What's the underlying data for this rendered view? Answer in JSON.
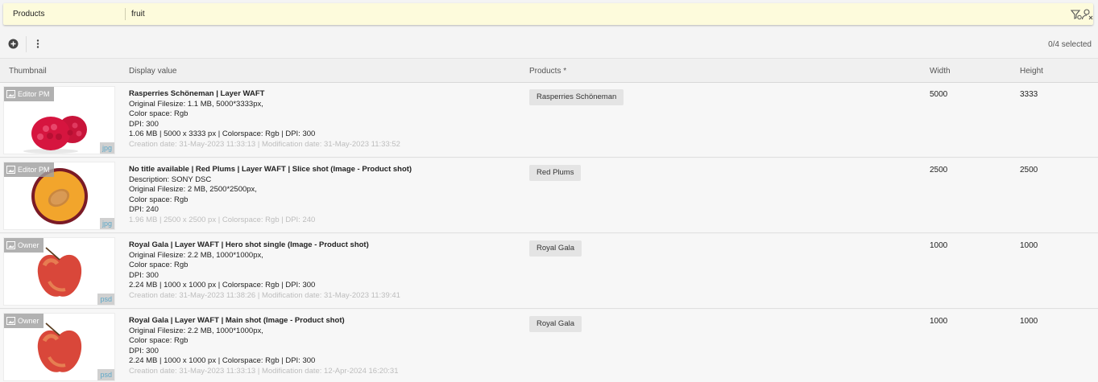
{
  "search": {
    "scope": "Products",
    "query": "fruit"
  },
  "toolbar": {
    "selection": "0/4 selected"
  },
  "columns": {
    "thumbnail": "Thumbnail",
    "display_value": "Display value",
    "products": "Products *",
    "width": "Width",
    "height": "Height"
  },
  "rows": [
    {
      "badge": "Editor PM",
      "ext": "jpg",
      "title": "Rasperries Schöneman | Layer WAFT",
      "lines": [
        "Original Filesize: 1.1 MB, 5000*3333px,",
        "Color space: Rgb",
        "DPI: 300",
        "1.06 MB | 5000 x 3333 px | Colorspace: Rgb | DPI: 300"
      ],
      "faded": "Creation date: 31-May-2023 11:33:13 | Modification date: 31-May-2023 11:33:52",
      "product": "Rasperries Schöneman",
      "width": "5000",
      "height": "3333"
    },
    {
      "badge": "Editor PM",
      "ext": "jpg",
      "title": "No title available | Red Plums | Layer WAFT | Slice shot (Image - Product shot)",
      "lines": [
        "Description: SONY DSC",
        "Original Filesize: 2 MB, 2500*2500px,",
        "Color space: Rgb",
        "DPI: 240"
      ],
      "faded": "1.96 MB | 2500 x 2500 px | Colorspace: Rgb | DPI: 240",
      "product": "Red Plums",
      "width": "2500",
      "height": "2500"
    },
    {
      "badge": "Owner",
      "ext": "psd",
      "title": "Royal Gala | Layer WAFT | Hero shot single (Image - Product shot)",
      "lines": [
        "Original Filesize: 2.2 MB, 1000*1000px,",
        "Color space: Rgb",
        "DPI: 300",
        "2.24 MB | 1000 x 1000 px | Colorspace: Rgb | DPI: 300"
      ],
      "faded": "Creation date: 31-May-2023 11:38:26 | Modification date: 31-May-2023 11:39:41",
      "product": "Royal Gala",
      "width": "1000",
      "height": "1000"
    },
    {
      "badge": "Owner",
      "ext": "psd",
      "title": "Royal Gala | Layer WAFT | Main shot (Image - Product shot)",
      "lines": [
        "Original Filesize: 2.2 MB, 1000*1000px,",
        "Color space: Rgb",
        "DPI: 300",
        "2.24 MB | 1000 x 1000 px | Colorspace: Rgb | DPI: 300"
      ],
      "faded": "Creation date: 31-May-2023 11:33:13 | Modification date: 12-Apr-2024 16:20:31",
      "product": "Royal Gala",
      "width": "1000",
      "height": "1000"
    }
  ],
  "icons": [
    "filter-settings-icon",
    "user-clear-icon",
    "add-circle-icon",
    "more-vertical-icon",
    "image-icon"
  ]
}
